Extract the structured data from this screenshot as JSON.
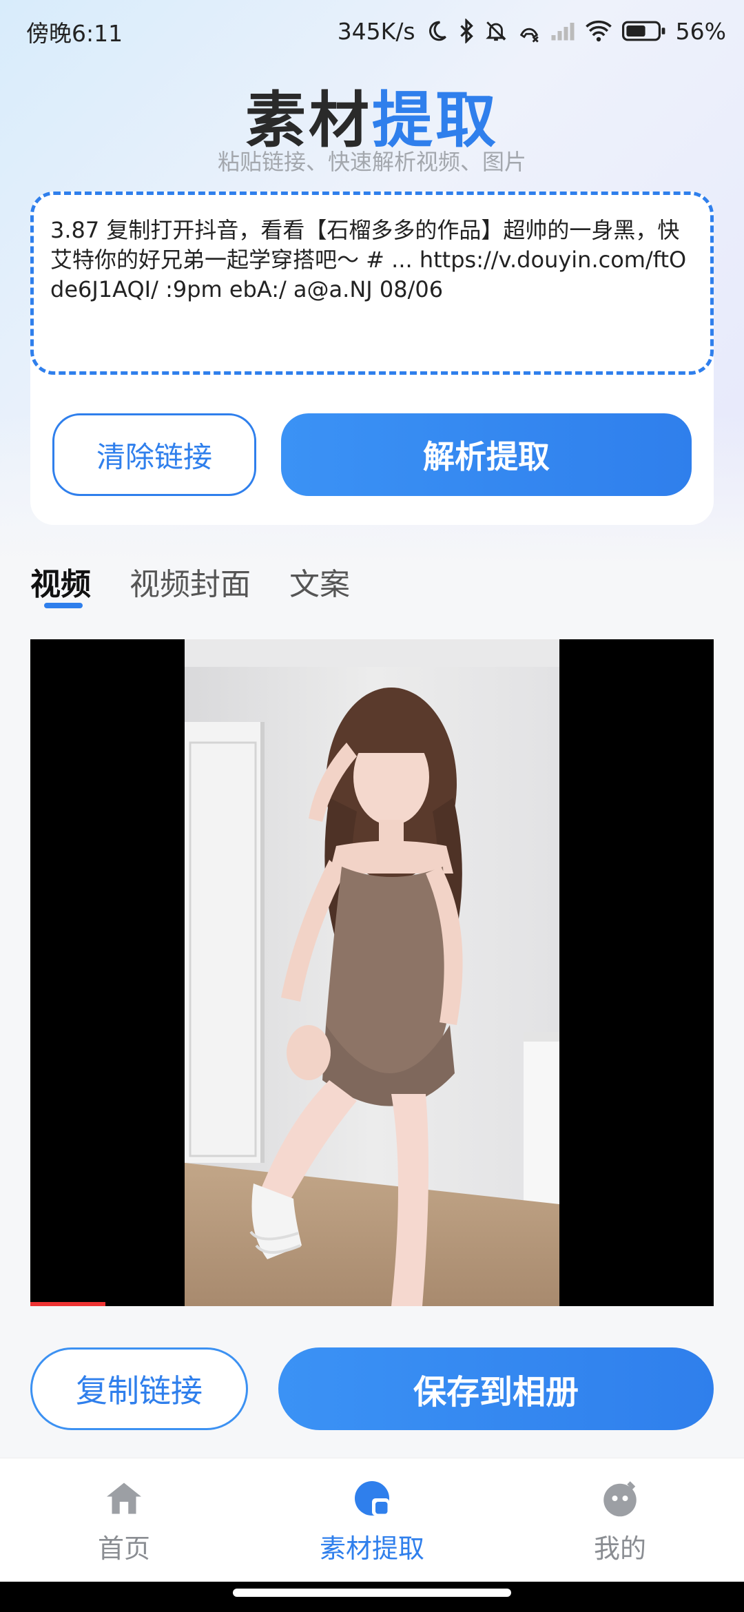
{
  "status_bar": {
    "time": "傍晚6:11",
    "speed": "345K/s",
    "battery": "56%"
  },
  "header": {
    "title_part1": "素材",
    "title_part2": "提取",
    "subtitle": "粘贴链接、快速解析视频、图片"
  },
  "input": {
    "text": "3.87 复制打开抖音，看看【石榴多多的作品】超帅的一身黑，快艾特你的好兄弟一起学穿搭吧～ # ... https://v.douyin.com/ftOde6J1AQI/ :9pm ebA:/ a@a.NJ 08/06"
  },
  "buttons": {
    "clear": "清除链接",
    "parse": "解析提取",
    "copy": "复制链接",
    "save": "保存到相册"
  },
  "tabs": [
    {
      "label": "视频",
      "active": true
    },
    {
      "label": "视频封面",
      "active": false
    },
    {
      "label": "文案",
      "active": false
    }
  ],
  "video": {
    "progress": 0.11
  },
  "nav": [
    {
      "label": "首页",
      "icon": "home-icon",
      "active": false
    },
    {
      "label": "素材提取",
      "icon": "extract-icon",
      "active": true
    },
    {
      "label": "我的",
      "icon": "profile-icon",
      "active": false
    }
  ],
  "colors": {
    "accent": "#2f7fec",
    "text": "#222222",
    "muted": "#a3a7ad"
  }
}
